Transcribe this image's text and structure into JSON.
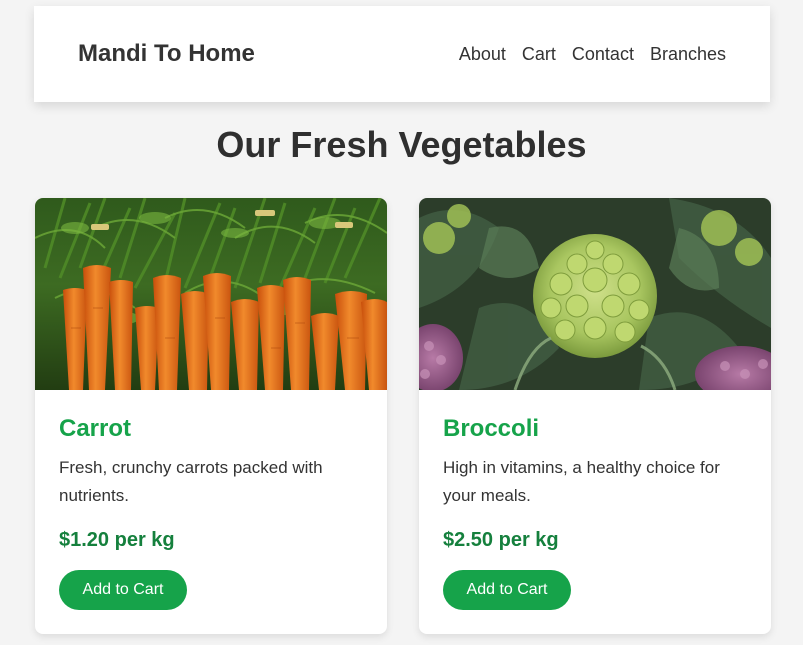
{
  "nav": {
    "brand": "Mandi To Home",
    "links": [
      "About",
      "Cart",
      "Contact",
      "Branches"
    ]
  },
  "page": {
    "title": "Our Fresh Vegetables"
  },
  "products": [
    {
      "name": "Carrot",
      "description": "Fresh, crunchy carrots packed with nutrients.",
      "price": "$1.20 per kg",
      "button_label": "Add to Cart"
    },
    {
      "name": "Broccoli",
      "description": "High in vitamins, a healthy choice for your meals.",
      "price": "$2.50 per kg",
      "button_label": "Add to Cart"
    }
  ],
  "colors": {
    "accent": "#16a34a",
    "price": "#15803d",
    "background": "#f4f4f4",
    "text": "#333333"
  }
}
